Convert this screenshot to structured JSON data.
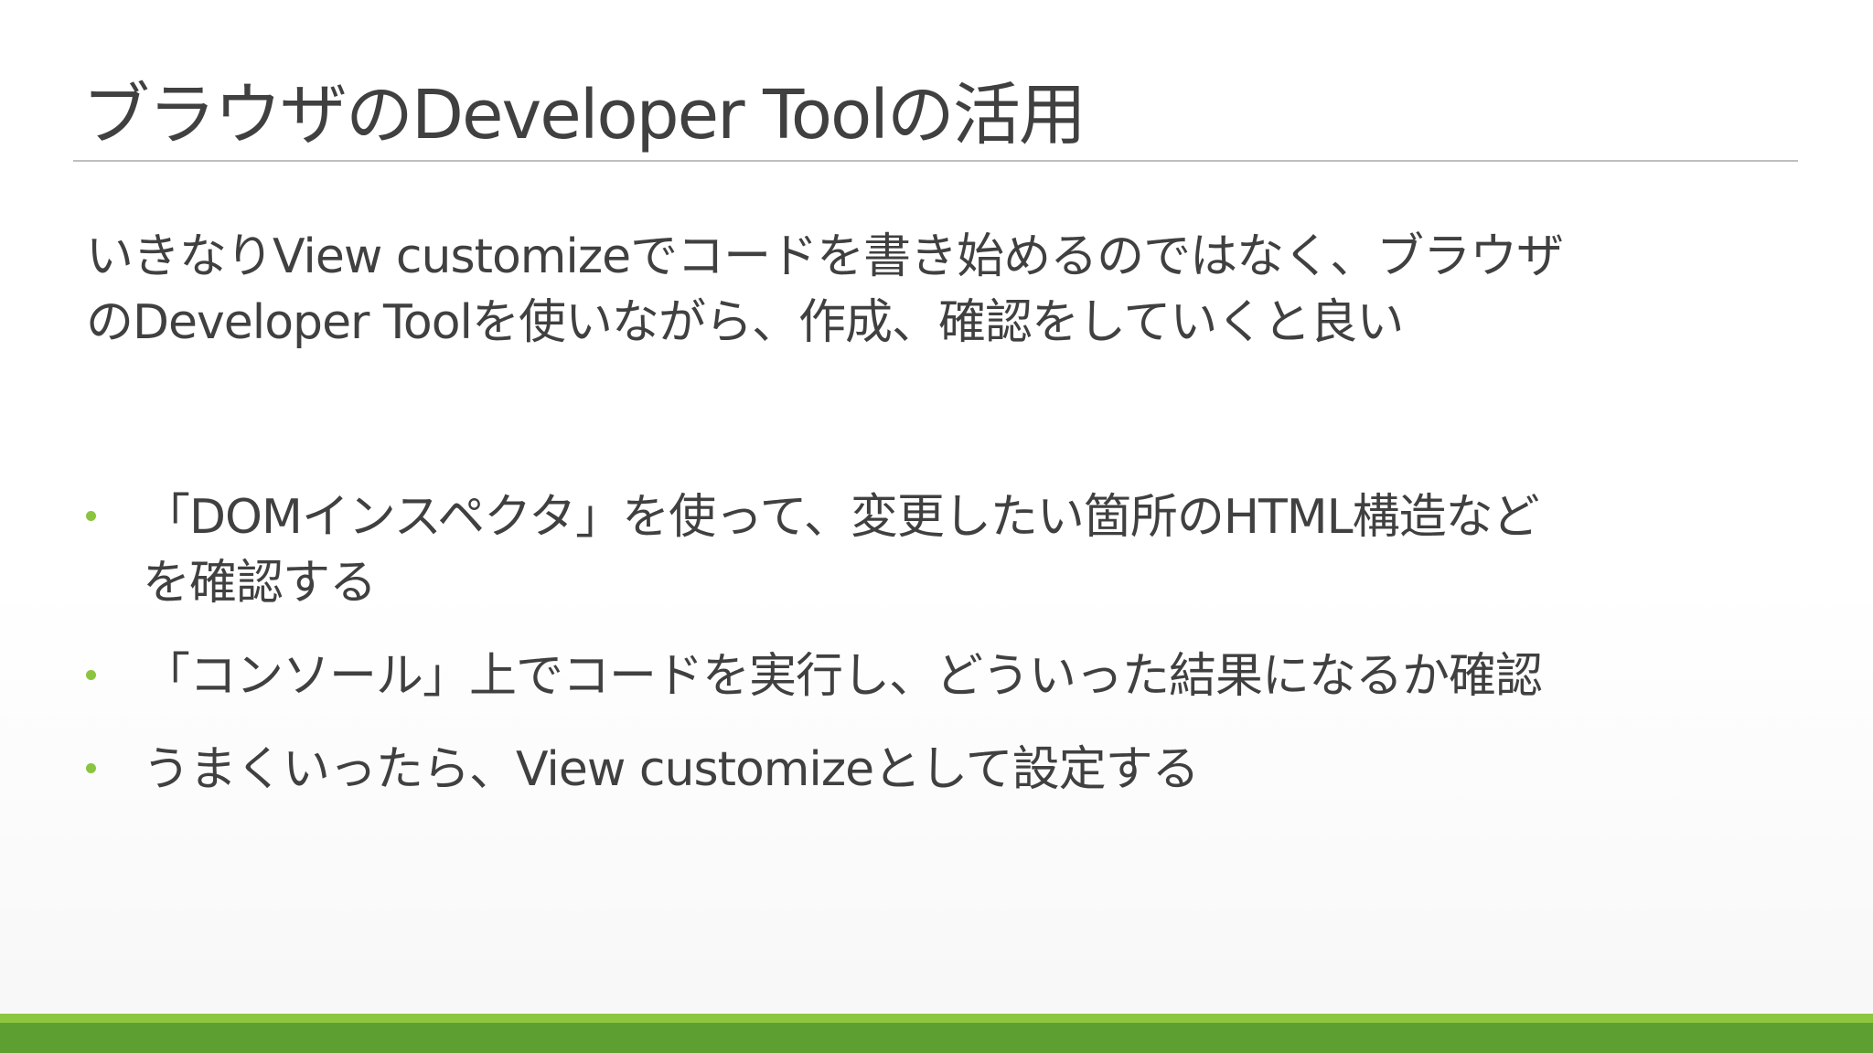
{
  "slide": {
    "title": "ブラウザのDeveloper Toolの活用",
    "intro": {
      "line1": "いきなりView customizeでコードを書き始めるのではなく、ブラウザ",
      "line2": "のDeveloper Toolを使いながら、作成、確認をしていくと良い"
    },
    "bullets": [
      {
        "line1": "「DOMインスペクタ」を使って、変更したい箇所のHTML構造など",
        "line2": "を確認する"
      },
      {
        "line1": "「コンソール」上でコードを実行し、どういった結果になるか確認"
      },
      {
        "line1": "うまくいったら、View customizeとして設定する"
      }
    ]
  },
  "colors": {
    "accent": "#8bc53f",
    "footer_light": "#8dc63f",
    "footer_dark": "#5e9f32",
    "text": "#404040"
  }
}
